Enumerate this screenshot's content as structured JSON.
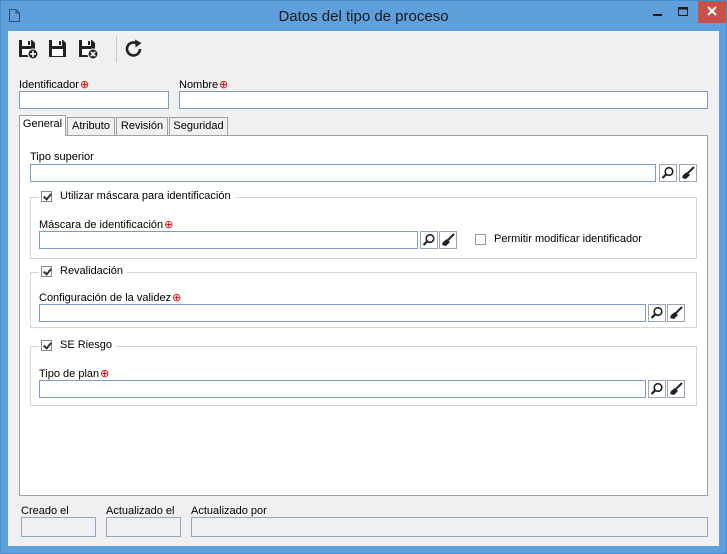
{
  "window": {
    "title": "Datos del tipo de proceso",
    "title_color": "#5fa0dc",
    "close_color": "#c7504a"
  },
  "toolbar": {
    "items": [
      "save-and-new-icon",
      "save-icon",
      "save-and-close-icon",
      "refresh-icon"
    ]
  },
  "header": {
    "identificador_label": "Identificador",
    "identificador_value": "",
    "nombre_label": "Nombre",
    "nombre_value": ""
  },
  "tabs": [
    {
      "label": "General",
      "active": true
    },
    {
      "label": "Atributo",
      "active": false
    },
    {
      "label": "Revisión",
      "active": false
    },
    {
      "label": "Seguridad",
      "active": false
    }
  ],
  "general": {
    "tipo_superior_label": "Tipo superior",
    "tipo_superior_value": "",
    "mascara_group": {
      "checkbox_label": "Utilizar máscara para identificación",
      "checked": true,
      "field_label": "Máscara de identificación",
      "field_value": "",
      "permitir_label": "Permitir modificar identificador",
      "permitir_checked": false
    },
    "revalidacion_group": {
      "checkbox_label": "Revalidación",
      "checked": true,
      "field_label": "Configuración de la validez",
      "field_value": ""
    },
    "riesgo_group": {
      "checkbox_label": "SE Riesgo",
      "checked": true,
      "field_label": "Tipo de plan",
      "field_value": ""
    }
  },
  "footer": {
    "creado_label": "Creado el",
    "creado_value": "",
    "actualizado_label": "Actualizado el",
    "actualizado_value": "",
    "actualizado_por_label": "Actualizado por",
    "actualizado_por_value": ""
  }
}
